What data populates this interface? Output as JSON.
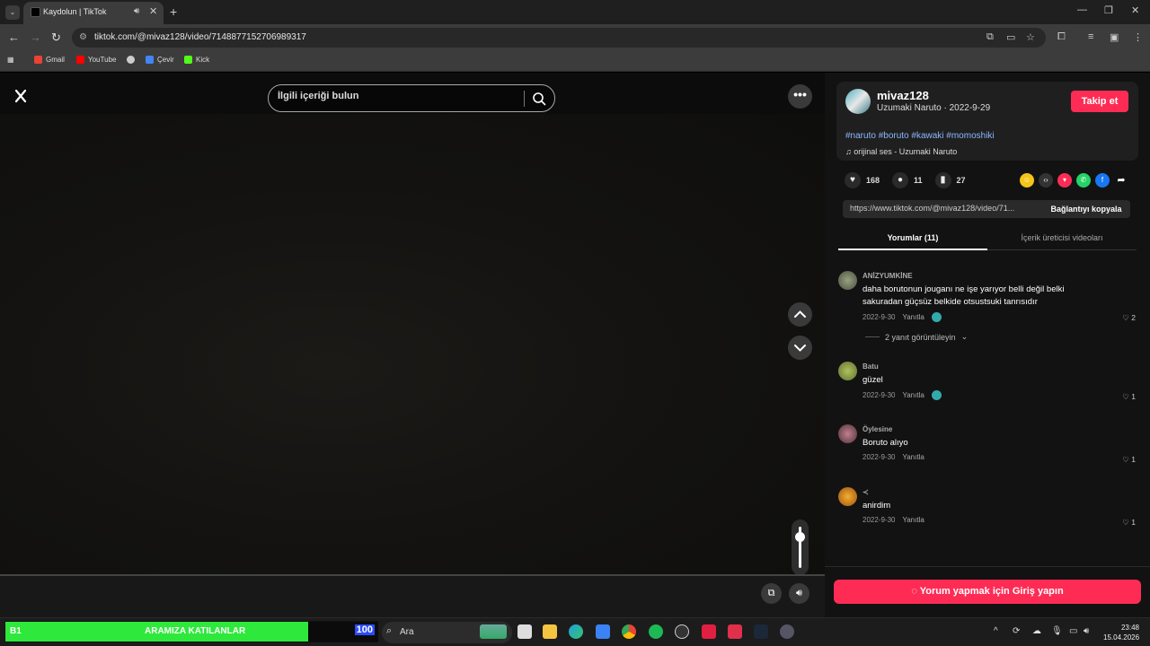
{
  "browser": {
    "tab_title": "Kaydolun | TikTok",
    "url": "tiktok.com/@mivaz128/video/7148877152706989317",
    "bookmarks": [
      {
        "label": "Gmail",
        "color": "#ea4335"
      },
      {
        "label": "YouTube",
        "color": "#ff0000"
      },
      {
        "label": "",
        "color": "#cccccc"
      },
      {
        "label": "Çevir",
        "color": "#4285f4"
      },
      {
        "label": "Kick",
        "color": "#53fc18"
      }
    ]
  },
  "video": {
    "search_placeholder": "İlgili içeriği bulun",
    "volume_level": 0.8
  },
  "author": {
    "username": "mivaz128",
    "subtitle": "Uzumaki Naruto · 2022-9-29",
    "follow_label": "Takip et",
    "hashtags": "#naruto #boruto #kawaki #momoshiki",
    "music": "orijinal ses - Uzumaki Naruto"
  },
  "stats": {
    "likes": "168",
    "comments": "11",
    "saves": "27"
  },
  "share": {
    "link": "https://www.tiktok.com/@mivaz128/video/71...",
    "copy_label": "Bağlantıyı kopyala"
  },
  "tabs": {
    "comments": "Yorumlar (11)",
    "creator_videos": "İçerik üreticisi videoları"
  },
  "comments": [
    {
      "name": "ANİZYUMKİNE",
      "text": "daha borutonun jouganı ne işe yarıyor belli değil belki sakuradan güçsüz belkide otsustsuki tanrısıdır",
      "date": "2022-9-30",
      "reply": "Yanıtla",
      "likes": "2"
    },
    {
      "name": "Batu",
      "text": "güzel",
      "date": "2022-9-30",
      "reply": "Yanıtla",
      "likes": "1"
    },
    {
      "name": "Öylesine",
      "text": "Boruto alıyo",
      "date": "2022-9-30",
      "reply": "Yanıtla",
      "likes": "1"
    },
    {
      "name": "≺",
      "text": "anirdim",
      "date": "2022-9-30",
      "reply": "Yanıtla",
      "likes": "1"
    }
  ],
  "view_replies": "2 yanıt görüntüleyin",
  "login_label": "Yorum yapmak için Giriş yapın",
  "taskbar": {
    "widget_left": "B1",
    "widget_title": "ARAMIZA KATILANLAR",
    "widget_score": "100",
    "search_label": "Ara",
    "time": "23:48",
    "date": "15.04.2026"
  },
  "colors": {
    "accent": "#fe2c55",
    "hashtag": "#8cb8ff",
    "widget_green": "#2ee83c"
  }
}
